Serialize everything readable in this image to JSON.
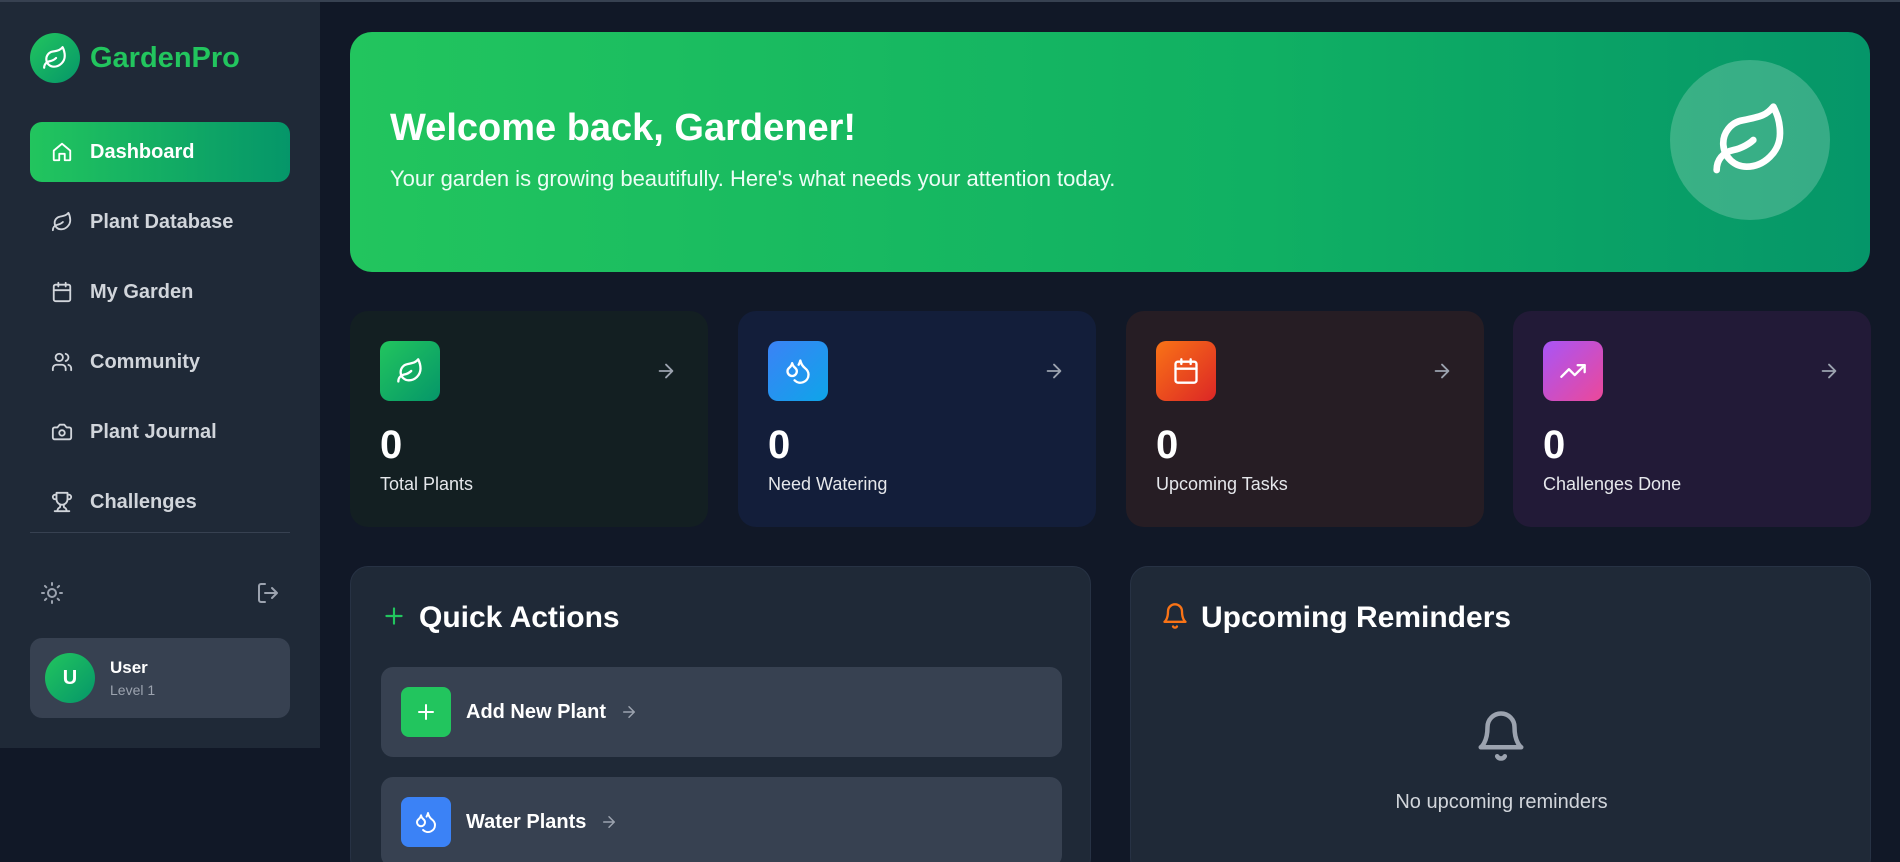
{
  "brand": {
    "name": "GardenPro",
    "logo_icon": "leaf-icon"
  },
  "sidebar": {
    "items": [
      {
        "label": "Dashboard",
        "icon": "home-icon",
        "active": true
      },
      {
        "label": "Plant Database",
        "icon": "leaf-icon"
      },
      {
        "label": "My Garden",
        "icon": "calendar-icon"
      },
      {
        "label": "Community",
        "icon": "users-icon"
      },
      {
        "label": "Plant Journal",
        "icon": "camera-icon"
      },
      {
        "label": "Challenges",
        "icon": "trophy-icon"
      }
    ],
    "tools": {
      "theme_icon": "sun-icon",
      "logout_icon": "logout-icon"
    },
    "user": {
      "initial": "U",
      "name": "User",
      "level": "Level 1"
    }
  },
  "hero": {
    "title": "Welcome back, Gardener!",
    "subtitle": "Your garden is growing beautifully. Here's what needs your attention today.",
    "icon": "leaf-icon"
  },
  "stats": [
    {
      "value": "0",
      "label": "Total Plants",
      "icon": "leaf-icon",
      "accent": "#22c55e"
    },
    {
      "value": "0",
      "label": "Need Watering",
      "icon": "droplets-icon",
      "accent": "#3b82f6"
    },
    {
      "value": "0",
      "label": "Upcoming Tasks",
      "icon": "calendar-icon",
      "accent": "#f97316"
    },
    {
      "value": "0",
      "label": "Challenges Done",
      "icon": "trending-up-icon",
      "accent": "#a855f7"
    }
  ],
  "quick_actions": {
    "title": "Quick Actions",
    "items": [
      {
        "label": "Add New Plant",
        "icon": "plus-icon",
        "color": "#22c55e"
      },
      {
        "label": "Water Plants",
        "icon": "droplets-icon",
        "color": "#3b82f6"
      }
    ]
  },
  "reminders": {
    "title": "Upcoming Reminders",
    "empty_text": "No upcoming reminders"
  },
  "colors": {
    "background": "#111827",
    "sidebar": "#1f2937",
    "brand_green": "#22c55e",
    "reminder_bell": "#f97316"
  }
}
